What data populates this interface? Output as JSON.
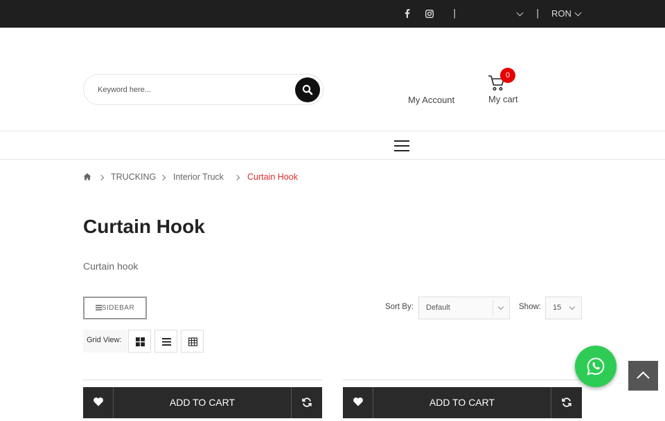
{
  "topbar": {
    "social_icons": [
      "facebook-icon",
      "instagram-icon"
    ],
    "separator": "|",
    "language_value": "",
    "currency": "RON"
  },
  "header": {
    "search_placeholder": "Keyword here...",
    "search_icon": "search-icon",
    "my_account": "My Account",
    "cart_count": "0",
    "my_cart": "My cart"
  },
  "breadcrumb": {
    "home_icon": "home-icon",
    "items": [
      "TRUCKING",
      "Interior Truck",
      "Curtain Hook"
    ]
  },
  "page": {
    "title": "Curtain Hook",
    "description": "Curtain hook"
  },
  "toolbar": {
    "sidebar_label": "SIDEBAR",
    "sort_by_label": "Sort By:",
    "sort_value": "Default",
    "show_label": "Show:",
    "show_value": "15",
    "grid_view_label": "Grid View:"
  },
  "products": [
    {
      "add_to_cart": "ADD TO CART"
    },
    {
      "add_to_cart": "ADD TO CART"
    }
  ],
  "colors": {
    "topbar_bg": "#1f1f1f",
    "accent_red": "#e02b2b",
    "cart_badge": "#e60000",
    "whatsapp_green": "#2ecc55"
  }
}
